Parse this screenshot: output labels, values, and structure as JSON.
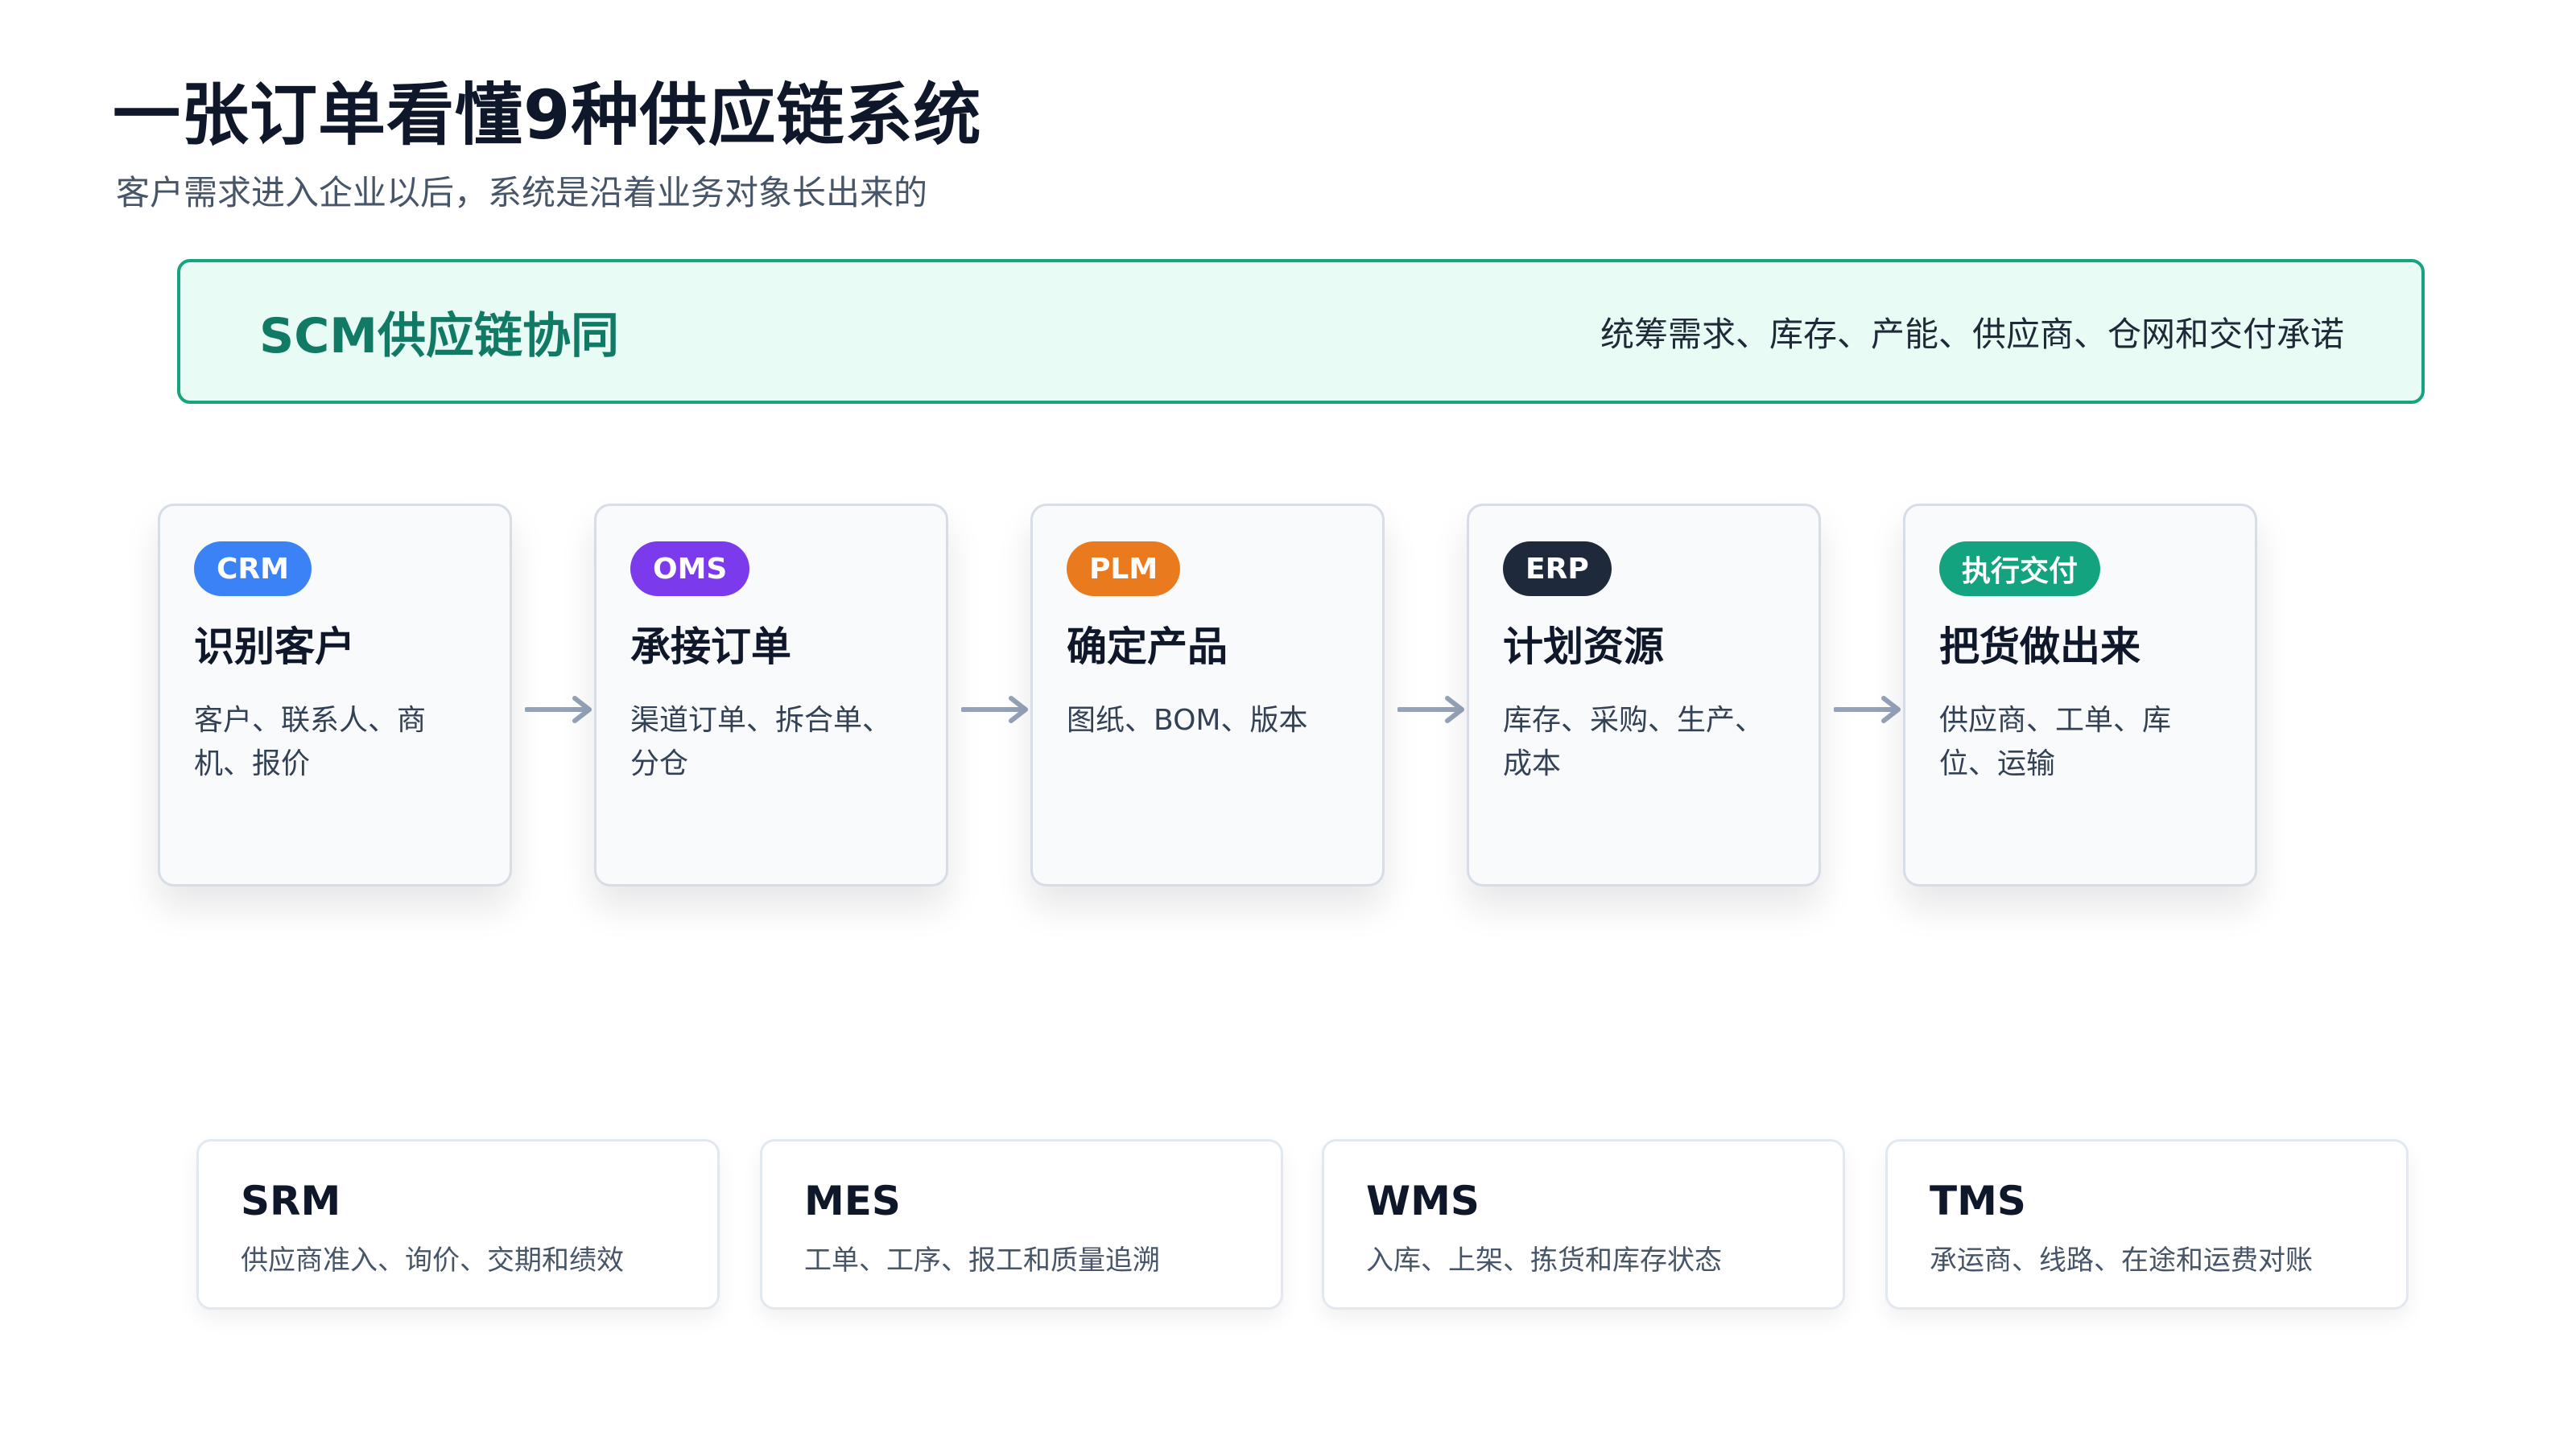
{
  "header": {
    "title": "一张订单看懂9种供应链系统",
    "subtitle": "客户需求进入企业以后，系统是沿着业务对象长出来的"
  },
  "scm": {
    "title": "SCM供应链协同",
    "description": "统筹需求、库存、产能、供应商、仓网和交付承诺"
  },
  "steps": [
    {
      "badge": "CRM",
      "badge_color": "#3b82f6",
      "title": "识别客户",
      "description": "客户、联系人、商机、报价"
    },
    {
      "badge": "OMS",
      "badge_color": "#7c3aed",
      "title": "承接订单",
      "description": "渠道订单、拆合单、分仓"
    },
    {
      "badge": "PLM",
      "badge_color": "#ea7a1e",
      "title": "确定产品",
      "description": "图纸、BOM、版本"
    },
    {
      "badge": "ERP",
      "badge_color": "#1e293b",
      "title": "计划资源",
      "description": "库存、采购、生产、成本"
    },
    {
      "badge": "执行交付",
      "badge_color": "#14a37f",
      "title": "把货做出来",
      "description": "供应商、工单、库位、运输"
    }
  ],
  "systems": [
    {
      "name": "SRM",
      "description": "供应商准入、询价、交期和绩效"
    },
    {
      "name": "MES",
      "description": "工单、工序、报工和质量追溯"
    },
    {
      "name": "WMS",
      "description": "入库、上架、拣货和库存状态"
    },
    {
      "name": "TMS",
      "description": "承运商、线路、在途和运费对账"
    }
  ],
  "colors": {
    "scm_border": "#16a37f",
    "scm_background": "#e8fbf4",
    "arrow": "#94a3b8"
  }
}
